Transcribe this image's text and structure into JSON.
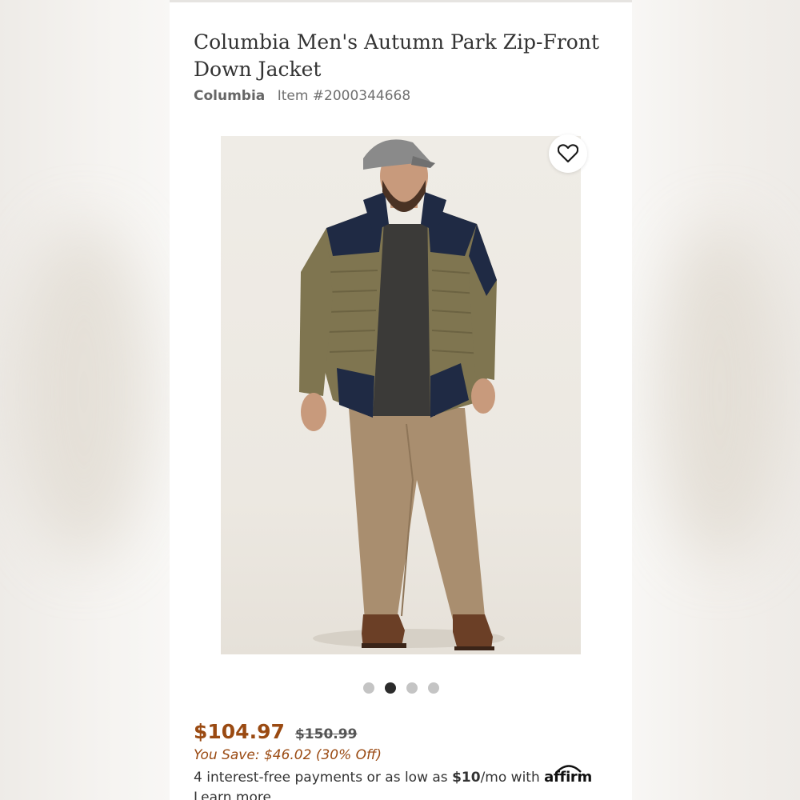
{
  "product": {
    "title": "Columbia Men's Autumn Park Zip-Front Down Jacket",
    "brand": "Columbia",
    "item_number": "Item #2000344668"
  },
  "gallery": {
    "image_count": 4,
    "active_index": 1,
    "icons": {
      "wishlist": "heart-outline-icon"
    }
  },
  "pricing": {
    "sale_price": "$104.97",
    "original_price": "$150.99",
    "savings": "You Save: $46.02 (30% Off)",
    "installments_prefix": "4 interest-free payments or as low as ",
    "installments_amount": "$10",
    "installments_suffix": "/mo with ",
    "provider": "affirm",
    "learn_more": "Learn more"
  },
  "colors": {
    "price": "#9a4a12",
    "text": "#333333",
    "muted": "#6f6f6f"
  }
}
